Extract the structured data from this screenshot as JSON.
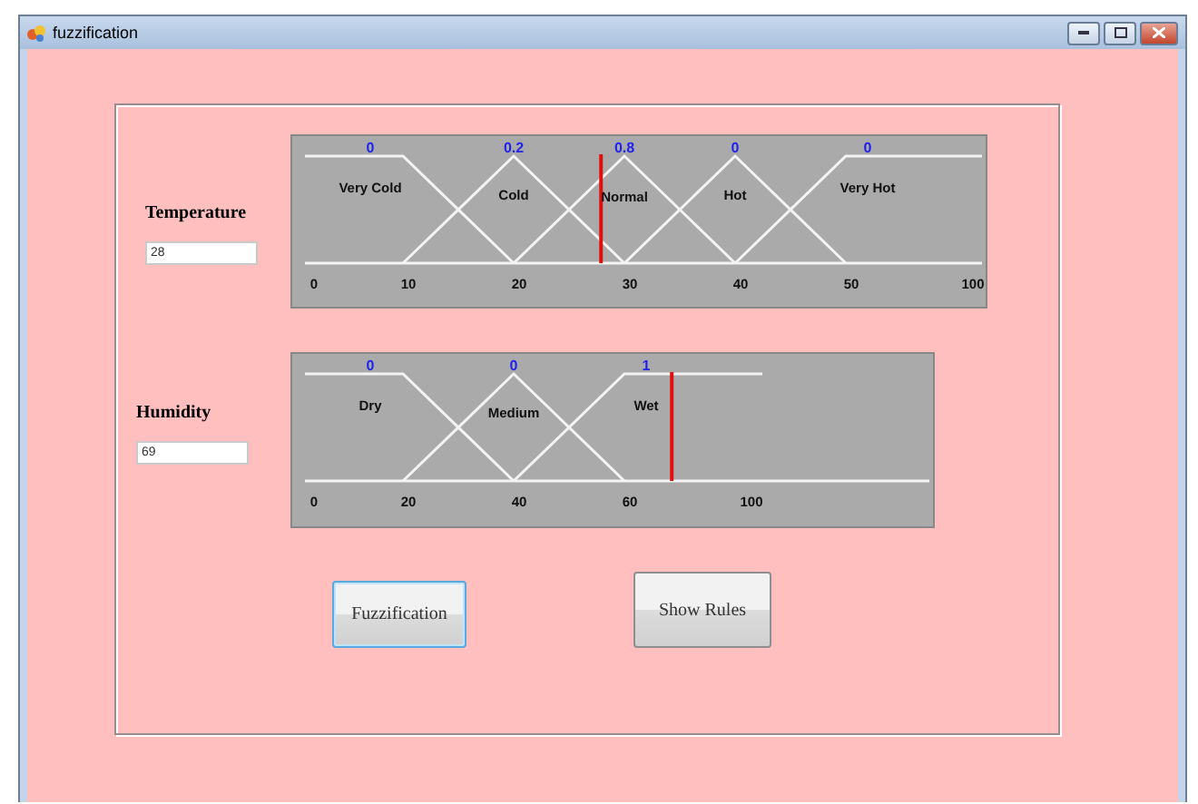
{
  "window": {
    "title": "fuzzification"
  },
  "variables": [
    {
      "label": "Temperature",
      "value": "28",
      "marker": {
        "level": 0.443
      },
      "sets": [
        {
          "name": "Very Cold",
          "degree": "0"
        },
        {
          "name": "Cold",
          "degree": "0.2"
        },
        {
          "name": "Normal",
          "degree": "0.8"
        },
        {
          "name": "Hot",
          "degree": "0"
        },
        {
          "name": "Very Hot",
          "degree": "0"
        }
      ],
      "ticks": [
        "0",
        "10",
        "20",
        "30",
        "40",
        "50",
        "100"
      ]
    },
    {
      "label": "Humidity",
      "value": "69",
      "marker": {
        "level": 0.589
      },
      "sets": [
        {
          "name": "Dry",
          "degree": "0"
        },
        {
          "name": "Medium",
          "degree": "0"
        },
        {
          "name": "Wet",
          "degree": "1"
        }
      ],
      "ticks": [
        "0",
        "20",
        "40",
        "60",
        "100"
      ]
    }
  ],
  "buttons": [
    {
      "label": "Fuzzification",
      "focused": true
    },
    {
      "label": "Show Rules",
      "focused": false
    }
  ]
}
